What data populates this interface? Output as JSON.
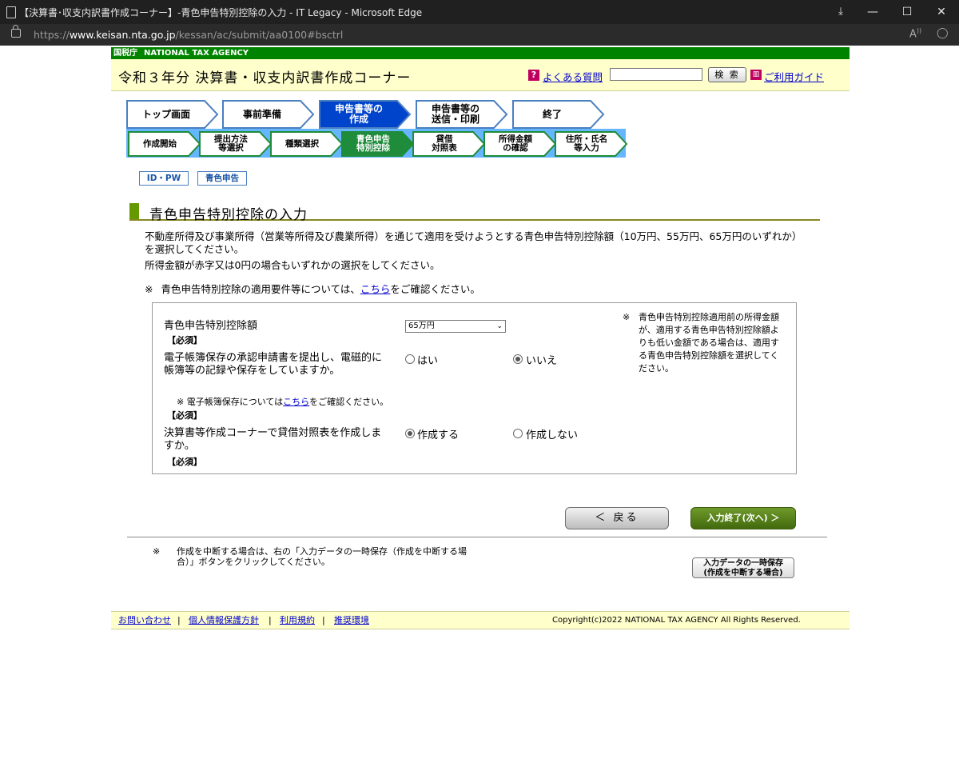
{
  "window": {
    "title": "【決算書･収支内訳書作成コーナー】-青色申告特別控除の入力 - IT Legacy - Microsoft Edge",
    "minimize": "—",
    "maximize": "☐",
    "close": "✕"
  },
  "address": {
    "scheme": "https://",
    "host": "www.keisan.nta.go.jp",
    "path": "/kessan/ac/submit/aa0100#bsctrl"
  },
  "header": {
    "agency_ja": "国税庁",
    "agency_en": "NATIONAL TAX AGENCY",
    "corner_title": "令和３年分 決算書・収支内訳書作成コーナー",
    "faq_icon": "?",
    "faq_link": "よくある質問",
    "search_button": "検 索",
    "guide_icon": "📖",
    "guide_link": "ご利用ガイド"
  },
  "steps_main": [
    {
      "label": "トップ画面"
    },
    {
      "label": "事前準備"
    },
    {
      "label": "申告書等の\n作成"
    },
    {
      "label": "申告書等の\n送信・印刷"
    },
    {
      "label": "終了"
    }
  ],
  "steps_sub": [
    {
      "label": "作成開始"
    },
    {
      "label": "提出方法\n等選択"
    },
    {
      "label": "種類選択"
    },
    {
      "label": "青色申告\n特別控除"
    },
    {
      "label": "貸借\n対照表"
    },
    {
      "label": "所得金額\nの確認"
    },
    {
      "label": "住所・氏名\n等入力"
    }
  ],
  "tags": [
    "ID・PW",
    "青色申告"
  ],
  "section_title": "青色申告特別控除の入力",
  "description": "不動産所得及び事業所得（営業等所得及び農業所得）を通じて適用を受けようとする青色申告特別控除額（10万円、55万円、65万円のいずれか）を選択してください。",
  "description2": "所得金額が赤字又は0円の場合もいずれかの選択をしてください。",
  "note": {
    "mark": "※",
    "before": "青色申告特別控除の適用要件等については、",
    "link": "こちら",
    "after": "をご確認ください。"
  },
  "form": {
    "q1": {
      "label": "青色申告特別控除額",
      "required": "【必須】",
      "selected": "65万円",
      "arrow": "⌄"
    },
    "q2": {
      "label": "電子帳簿保存の承認申請書を提出し、電磁的に帳簿等の記録や保存をしていますか。",
      "required": "【必須】",
      "options": [
        "はい",
        "いいえ"
      ],
      "selected": "いいえ",
      "subnote_mark": "※",
      "subnote_before": "電子帳簿保存については",
      "subnote_link": "こちら",
      "subnote_after": "をご確認ください。"
    },
    "q3": {
      "label": "決算書等作成コーナーで貸借対照表を作成しますか。",
      "required": "【必須】",
      "options": [
        "作成する",
        "作成しない"
      ],
      "selected": "作成する"
    },
    "side_note_mark": "※",
    "side_note": "青色申告特別控除適用前の所得金額が、適用する青色申告特別控除額よりも低い金額である場合は、適用する青色申告特別控除額を選択してください。"
  },
  "buttons": {
    "back": "＜ 戻る",
    "next": "入力終了(次へ) ＞",
    "save_line1": "入力データの一時保存",
    "save_line2": "(作成を中断する場合)"
  },
  "bottom_note_mark": "※",
  "bottom_note": "作成を中断する場合は、右の「入力データの一時保存（作成を中断する場合）」ボタンをクリックしてください。",
  "footer": {
    "links": [
      "お問い合わせ",
      "個人情報保護方針",
      "利用規約",
      "推奨環境"
    ],
    "separator": "|",
    "copyright": "Copyright(c)2022 NATIONAL TAX AGENCY All Rights Reserved."
  },
  "colors": {
    "agency_green": "#008400",
    "header_yellow": "#ffffcc",
    "step_active": "#0044cc",
    "step_bar": "#66b6ff",
    "next_button": "#4f7a14"
  }
}
